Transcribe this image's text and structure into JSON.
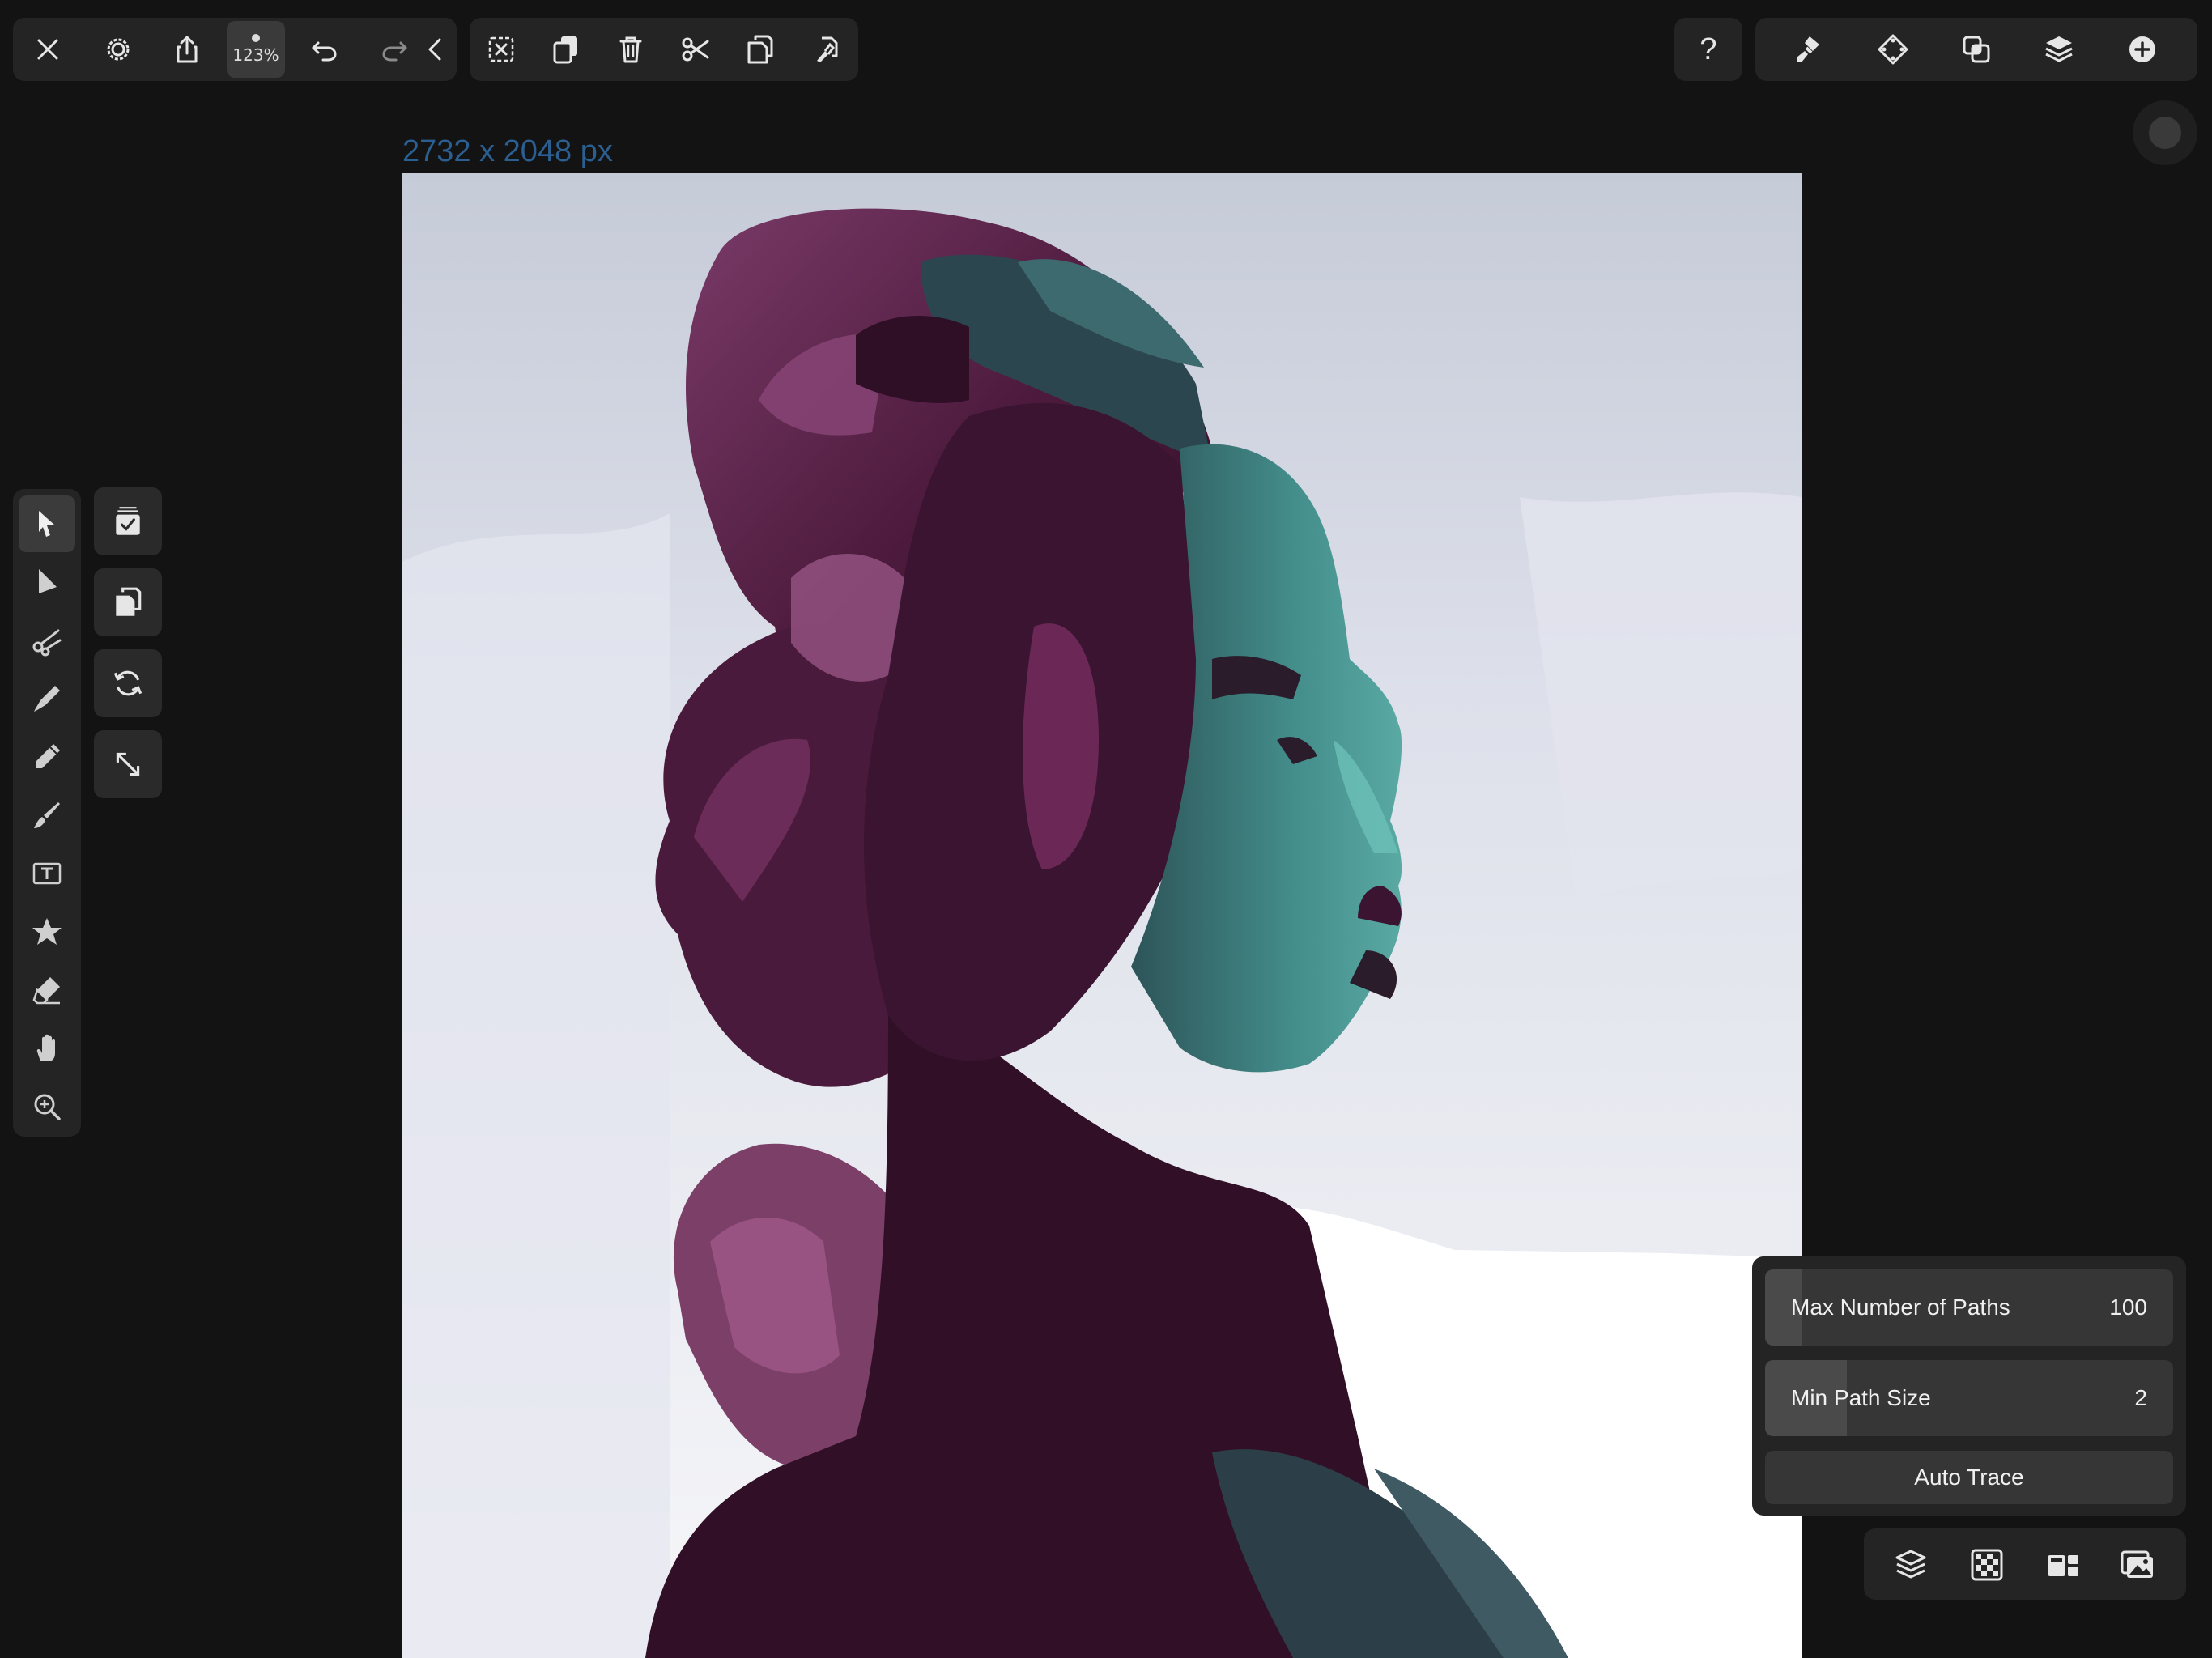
{
  "top_toolbar": {
    "zoom_label": "123%"
  },
  "canvas": {
    "size_label": "2732 x 2048 px"
  },
  "help": {
    "label": "?"
  },
  "trace_panel": {
    "max_paths_label": "Max Number of Paths",
    "max_paths_value": "100",
    "max_paths_fill": 0.09,
    "min_path_size_label": "Min Path Size",
    "min_path_size_value": "2",
    "min_path_size_fill": 0.2,
    "auto_trace_label": "Auto Trace"
  },
  "colors": {
    "background": "#131313",
    "panel": "#242424",
    "canvas_size_text": "#2c5f91",
    "portrait_magenta": "#5a1f46",
    "portrait_teal": "#3f8b8a"
  }
}
